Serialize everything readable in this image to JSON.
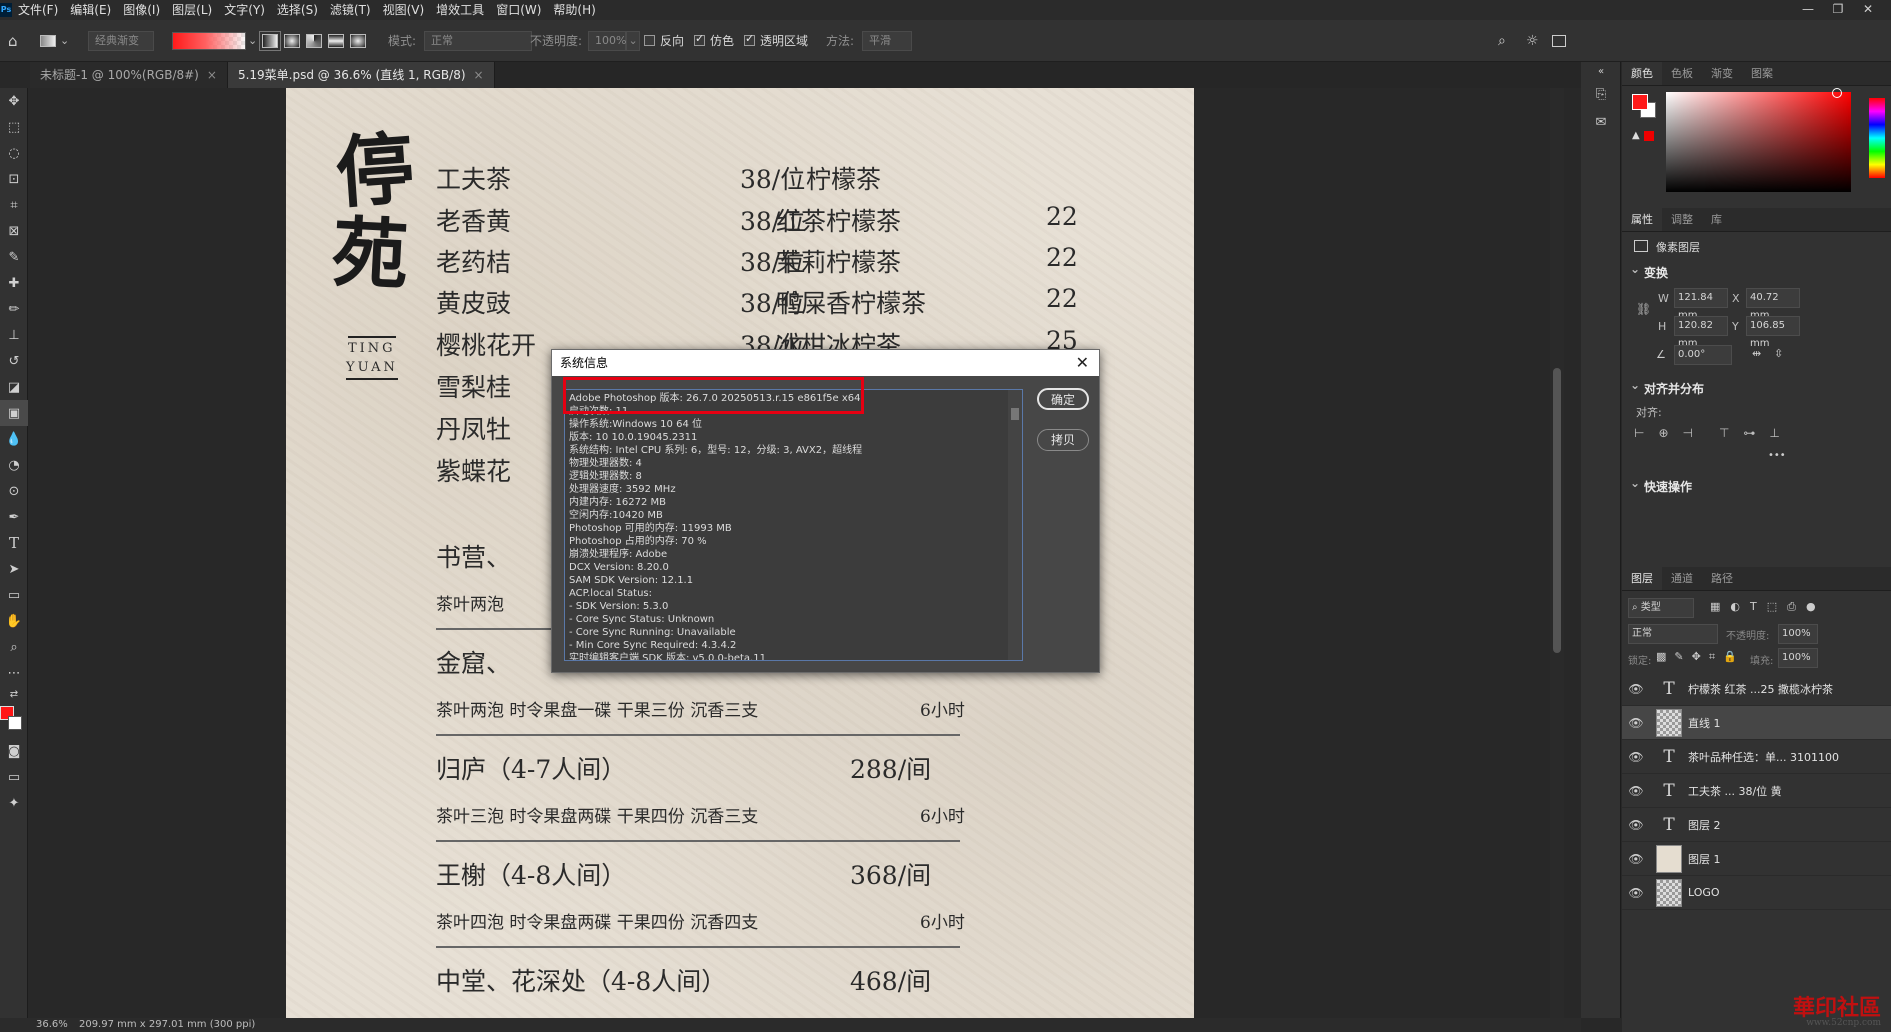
{
  "menubar": {
    "logo": "Ps",
    "items": [
      "文件(F)",
      "编辑(E)",
      "图像(I)",
      "图层(L)",
      "文字(Y)",
      "选择(S)",
      "滤镜(T)",
      "视图(V)",
      "增效工具",
      "窗口(W)",
      "帮助(H)"
    ],
    "window_controls": [
      "—",
      "❐",
      "✕"
    ]
  },
  "options": {
    "preset": "经典渐变",
    "mode_label": "模式:",
    "mode_value": "正常",
    "opacity_label": "不透明度:",
    "opacity_value": "100%",
    "reverse_label": "反向",
    "dither_label": "仿色",
    "transparency_label": "透明区域",
    "method_label": "方法:",
    "method_value": "平滑",
    "reverse_checked": false,
    "dither_checked": true,
    "transparency_checked": true
  },
  "tabs": [
    {
      "label": "未标题-1 @ 100%(RGB/8#)",
      "active": false
    },
    {
      "label": "5.19菜单.psd @ 36.6% (直线 1, RGB/8)",
      "active": true
    }
  ],
  "menu_doc": {
    "logo_line1": "停",
    "logo_line2": "苑",
    "logo_sub1": "TING",
    "logo_sub2": "YUAN",
    "left_col": [
      {
        "name": "工夫茶",
        "price": "38/位"
      },
      {
        "name": "老香黄",
        "price": "38/位"
      },
      {
        "name": "老药桔",
        "price": "38/位"
      },
      {
        "name": "黄皮豉",
        "price": "38/位"
      },
      {
        "name": "樱桃花开",
        "price": "38/位"
      },
      {
        "name": "雪梨桂",
        "price": ""
      },
      {
        "name": "丹凤牡",
        "price": ""
      },
      {
        "name": "紫蝶花",
        "price": ""
      }
    ],
    "right_col": [
      {
        "name": "柠檬茶",
        "price": ""
      },
      {
        "name": "红茶柠檬茶",
        "price": "22"
      },
      {
        "name": "茉莉柠檬茶",
        "price": "22"
      },
      {
        "name": "鸭屎香柠檬茶",
        "price": "22"
      },
      {
        "name": "冰柑冰柠茶",
        "price": "25"
      },
      {
        "name": "",
        "price": "5"
      }
    ],
    "shufu_title": "书营、",
    "shufu_desc": "茶叶两泡",
    "rooms": [
      {
        "title": "金窟、",
        "price": "",
        "desc": "茶叶两泡  时令果盘一碟  干果三份   沉香三支",
        "hours": "6小时"
      },
      {
        "title": "归庐（4-7人间）",
        "price": "288/间",
        "desc": "茶叶三泡  时令果盘两碟  干果四份   沉香三支",
        "hours": "6小时"
      },
      {
        "title": "王榭（4-8人间）",
        "price": "368/间",
        "desc": "茶叶四泡  时令果盘两碟  干果四份   沉香四支",
        "hours": "6小时"
      },
      {
        "title": "中堂、花深处（4-8人间）",
        "price": "468/间",
        "desc": "",
        "hours": ""
      }
    ]
  },
  "dialog": {
    "title": "系统信息",
    "close": "✕",
    "ok": "确定",
    "copy": "拷贝",
    "lines": [
      "Adobe Photoshop 版本: 26.7.0 20250513.r.15 e861f5e  x64",
      "启动次数: 11",
      "操作系统:Windows 10 64 位",
      "版本: 10 10.0.19045.2311",
      "系统结构: Intel CPU 系列: 6，型号: 12，分级: 3, AVX2，超线程",
      "物理处理器数: 4",
      "逻辑处理器数: 8",
      "处理器速度: 3592 MHz",
      "内建内存: 16272 MB",
      "空闲内存:10420 MB",
      "Photoshop 可用的内存: 11993 MB",
      "Photoshop 占用的内存: 70 %",
      "崩溃处理程序: Adobe",
      "DCX Version: 8.20.0",
      "SAM SDK Version: 12.1.1",
      "ACP.local Status:",
      " - SDK Version: 5.3.0",
      " - Core Sync Status: Unknown",
      " - Core Sync Running: Unavailable",
      " - Min Core Sync Required: 4.3.4.2",
      "实时编辑客户端 SDK 版本: v5.0.0-beta.11"
    ]
  },
  "color_panel": {
    "tabs": [
      "颜色",
      "色板",
      "渐变",
      "图案"
    ],
    "fg": "#ff1a1a",
    "bg": "#ffffff"
  },
  "props_panel": {
    "tabs": [
      "属性",
      "调整",
      "库"
    ],
    "layer_type": "像素图层",
    "transform_title": "变换",
    "w_label": "W",
    "w_value": "121.84 mm",
    "x_label": "X",
    "x_value": "40.72 mm",
    "h_label": "H",
    "h_value": "120.82 mm",
    "y_label": "Y",
    "y_value": "106.85 mm",
    "angle_value": "0.00°",
    "align_title": "对齐并分布",
    "align_label": "对齐:",
    "more": "•••",
    "quick_title": "快速操作"
  },
  "layers_panel": {
    "tabs": [
      "图层",
      "通道",
      "路径"
    ],
    "filter_placeholder": "类型",
    "blend_value": "正常",
    "opacity_label": "不透明度:",
    "opacity_value": "100%",
    "lock_label": "锁定:",
    "fill_label": "填充:",
    "fill_value": "100%",
    "layers": [
      {
        "type": "text",
        "name": "柠檬茶   红茶 ...25  撒榄冰柠茶",
        "selected": false
      },
      {
        "type": "image",
        "name": "直线 1",
        "selected": true
      },
      {
        "type": "text",
        "name": "茶叶品种任选：单... 3101100",
        "selected": false
      },
      {
        "type": "text",
        "name": "工夫茶            ...          38/位 黄",
        "selected": false
      },
      {
        "type": "text",
        "name": "图层 2",
        "selected": false
      },
      {
        "type": "image",
        "name": "图层 1",
        "selected": false
      },
      {
        "type": "image",
        "name": "LOGO",
        "selected": false
      }
    ]
  },
  "status": {
    "zoom": "36.6%",
    "size": "209.97 mm x 297.01 mm (300 ppi)"
  },
  "watermark": {
    "main": "華印社區",
    "sub": "www.52cnp.com"
  }
}
